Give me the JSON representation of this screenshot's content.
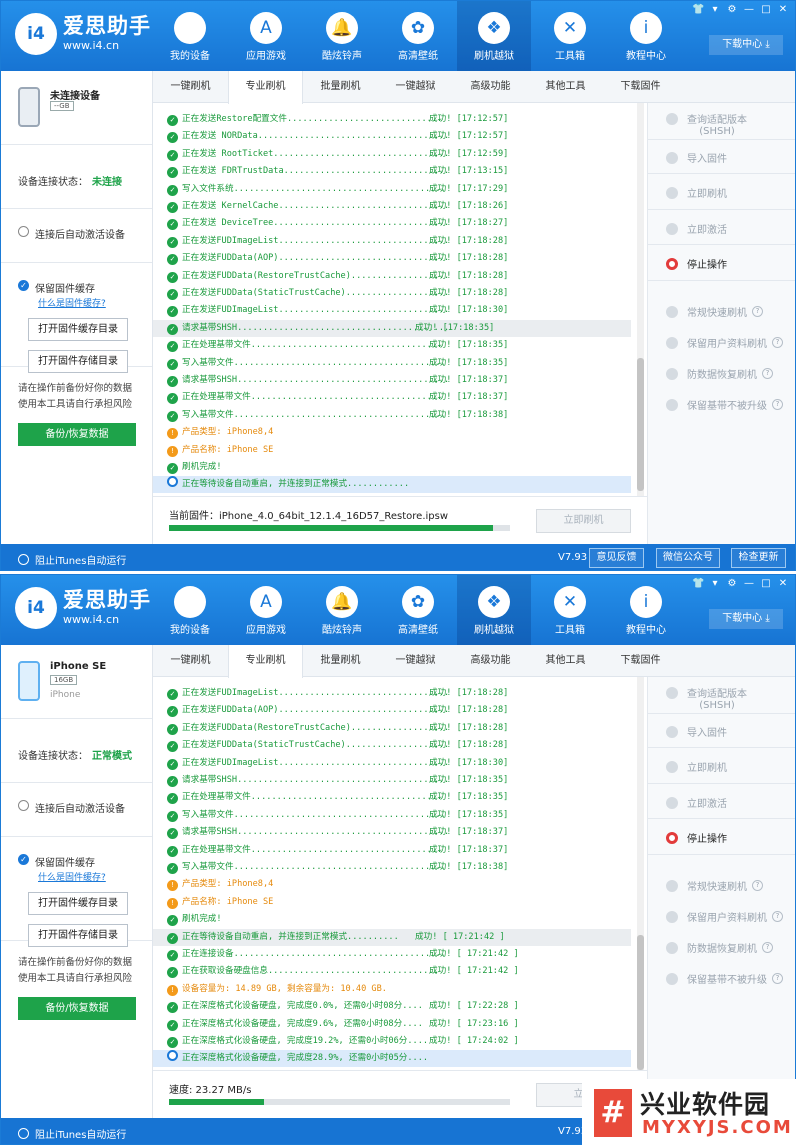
{
  "app": {
    "brand": "爱思助手",
    "url": "www.i4.cn",
    "logo": "i4",
    "download_center": "下载中心"
  },
  "titlebar": [
    "👕",
    "▾",
    "⚙",
    "—",
    "□",
    "✕"
  ],
  "nav": [
    {
      "label": "我的设备",
      "icon": "apple-icon",
      "glyph": ""
    },
    {
      "label": "应用游戏",
      "icon": "app-store-icon",
      "glyph": "A"
    },
    {
      "label": "酷炫铃声",
      "icon": "bell-icon",
      "glyph": "🔔"
    },
    {
      "label": "高清壁纸",
      "icon": "flower-icon",
      "glyph": "✿"
    },
    {
      "label": "刷机越狱",
      "icon": "dropbox-icon",
      "glyph": "❖"
    },
    {
      "label": "工具箱",
      "icon": "tools-icon",
      "glyph": "✕"
    },
    {
      "label": "教程中心",
      "icon": "info-icon",
      "glyph": "i"
    }
  ],
  "tabs": [
    "一键刷机",
    "专业刷机",
    "批量刷机",
    "一键越狱",
    "高级功能",
    "其他工具",
    "下载固件"
  ],
  "sidebar": {
    "status_label": "设备连接状态：",
    "auto_activate": "连接后自动激活设备",
    "keep_cache": "保留固件缓存",
    "what_cache": "什么是固件缓存?",
    "open_cache": "打开固件缓存目录",
    "open_store": "打开固件存储目录",
    "warn1": "请在操作前备份好你的数据",
    "warn2": "使用本工具请自行承担风险",
    "backup": "备份/恢复数据"
  },
  "right": {
    "query_version": "查询适配版本",
    "query_version2": "(SHSH)",
    "import_fw": "导入固件",
    "flash_now": "立即刷机",
    "activate_now": "立即激活",
    "stop": "停止操作",
    "opts": [
      "常规快速刷机",
      "保留用户资料刷机",
      "防数据恢复刷机",
      "保留基带不被升级"
    ]
  },
  "bottom": {
    "itunes": "阻止iTunes自动运行",
    "version": "V7.93",
    "feedback": "意见反馈",
    "wechat": "微信公众号",
    "update": "检查更新"
  },
  "win1": {
    "device_name": "未连接设备",
    "device_cap": "--GB",
    "device_sub": "",
    "status": "未连接",
    "footer_text": "当前固件：iPhone_4.0_64bit_12.1.4_16D57_Restore.ipsw",
    "progress": 95,
    "flash_btn": "立即刷机",
    "lines": [
      {
        "t": "正在发送Restore配置文件..............................",
        "s": "成功!",
        "time": "[17:12:57]",
        "k": "g"
      },
      {
        "t": "正在发送 NORData.....................................",
        "s": "成功!",
        "time": "[17:12:57]",
        "k": "g"
      },
      {
        "t": "正在发送 RootTicket..................................",
        "s": "成功!",
        "time": "[17:12:59]",
        "k": "g"
      },
      {
        "t": "正在发送 FDRTrustData................................",
        "s": "成功!",
        "time": "[17:13:15]",
        "k": "g"
      },
      {
        "t": "写入文件系统.........................................",
        "s": "成功!",
        "time": "[17:17:29]",
        "k": "g"
      },
      {
        "t": "正在发送 KernelCache.................................",
        "s": "成功!",
        "time": "[17:18:26]",
        "k": "g"
      },
      {
        "t": "正在发送 DeviceTree..................................",
        "s": "成功!",
        "time": "[17:18:27]",
        "k": "g"
      },
      {
        "t": "正在发送FUDImageList.................................",
        "s": "成功!",
        "time": "[17:18:28]",
        "k": "g"
      },
      {
        "t": "正在发送FUDData(AOP).................................",
        "s": "成功!",
        "time": "[17:18:28]",
        "k": "g"
      },
      {
        "t": "正在发送FUDData(RestoreTrustCache)...................",
        "s": "成功!",
        "time": "[17:18:28]",
        "k": "g"
      },
      {
        "t": "正在发送FUDData(StaticTrustCache)....................",
        "s": "成功!",
        "time": "[17:18:28]",
        "k": "g"
      },
      {
        "t": "正在发送FUDImageList.................................",
        "s": "成功!",
        "time": "[17:18:30]",
        "k": "g"
      },
      {
        "t": "请求基带SHSH.........................................",
        "s": "成功!",
        "time": "[17:18:35]",
        "k": "hl"
      },
      {
        "t": "正在处理基带文件.....................................",
        "s": "成功!",
        "time": "[17:18:35]",
        "k": "g"
      },
      {
        "t": "写入基带文件.........................................",
        "s": "成功!",
        "time": "[17:18:35]",
        "k": "g"
      },
      {
        "t": "请求基带SHSH.........................................",
        "s": "成功!",
        "time": "[17:18:37]",
        "k": "g"
      },
      {
        "t": "正在处理基带文件.....................................",
        "s": "成功!",
        "time": "[17:18:37]",
        "k": "g"
      },
      {
        "t": "写入基带文件.........................................",
        "s": "成功!",
        "time": "[17:18:38]",
        "k": "g"
      },
      {
        "t": "产品类型: iPhone8,4",
        "s": "",
        "time": "",
        "k": "o"
      },
      {
        "t": "产品名称: iPhone SE",
        "s": "",
        "time": "",
        "k": "o"
      },
      {
        "t": "刷机完成!",
        "s": "",
        "time": "",
        "k": "g"
      },
      {
        "t": "正在等待设备自动重启, 并连接到正常模式............",
        "s": "",
        "time": "",
        "k": "cur"
      }
    ]
  },
  "win2": {
    "device_name": "iPhone SE",
    "device_cap": "16GB",
    "device_sub": "iPhone",
    "status": "正常模式",
    "footer_text": "速度: 23.27 MB/s",
    "progress": 28,
    "flash_btn": "立即",
    "lines": [
      {
        "t": "正在发送FUDImageList.................................",
        "s": "成功!",
        "time": "[17:18:28]",
        "k": "g"
      },
      {
        "t": "正在发送FUDData(AOP).................................",
        "s": "成功!",
        "time": "[17:18:28]",
        "k": "g"
      },
      {
        "t": "正在发送FUDData(RestoreTrustCache)...................",
        "s": "成功!",
        "time": "[17:18:28]",
        "k": "g"
      },
      {
        "t": "正在发送FUDData(StaticTrustCache)....................",
        "s": "成功!",
        "time": "[17:18:28]",
        "k": "g"
      },
      {
        "t": "正在发送FUDImageList.................................",
        "s": "成功!",
        "time": "[17:18:30]",
        "k": "g"
      },
      {
        "t": "请求基带SHSH.........................................",
        "s": "成功!",
        "time": "[17:18:35]",
        "k": "g"
      },
      {
        "t": "正在处理基带文件.....................................",
        "s": "成功!",
        "time": "[17:18:35]",
        "k": "g"
      },
      {
        "t": "写入基带文件.........................................",
        "s": "成功!",
        "time": "[17:18:35]",
        "k": "g"
      },
      {
        "t": "请求基带SHSH.........................................",
        "s": "成功!",
        "time": "[17:18:37]",
        "k": "g"
      },
      {
        "t": "正在处理基带文件.....................................",
        "s": "成功!",
        "time": "[17:18:37]",
        "k": "g"
      },
      {
        "t": "写入基带文件.........................................",
        "s": "成功!",
        "time": "[17:18:38]",
        "k": "g"
      },
      {
        "t": "产品类型: iPhone8,4",
        "s": "",
        "time": "",
        "k": "o"
      },
      {
        "t": "产品名称: iPhone SE",
        "s": "",
        "time": "",
        "k": "o"
      },
      {
        "t": "刷机完成!",
        "s": "",
        "time": "",
        "k": "g"
      },
      {
        "t": "正在等待设备自动重启, 并连接到正常模式..........",
        "s": "成功!",
        "time": "[ 17:21:42 ]",
        "k": "hl"
      },
      {
        "t": "正在连接设备.........................................",
        "s": "成功!",
        "time": "[ 17:21:42 ]",
        "k": "g"
      },
      {
        "t": "正在获取设备硬盘信息.................................",
        "s": "成功!",
        "time": "[ 17:21:42 ]",
        "k": "g"
      },
      {
        "t": "设备容量为: 14.89 GB, 剩余容量为: 10.40 GB.",
        "s": "",
        "time": "",
        "k": "o"
      },
      {
        "t": "正在深度格式化设备硬盘, 完成度0.0%, 还需0小时08分....",
        "s": "成功!",
        "time": "[ 17:22:28 ]",
        "k": "g"
      },
      {
        "t": "正在深度格式化设备硬盘, 完成度9.6%, 还需0小时08分....",
        "s": "成功!",
        "time": "[ 17:23:16 ]",
        "k": "g"
      },
      {
        "t": "正在深度格式化设备硬盘, 完成度19.2%, 还需0小时06分....",
        "s": "成功!",
        "time": "[ 17:24:02 ]",
        "k": "g"
      },
      {
        "t": "正在深度格式化设备硬盘, 完成度28.9%, 还需0小时05分....",
        "s": "",
        "time": "",
        "k": "cur"
      }
    ]
  },
  "watermark": {
    "mark": "#",
    "title": "兴业软件园",
    "url": "MYXYJS.COM"
  }
}
